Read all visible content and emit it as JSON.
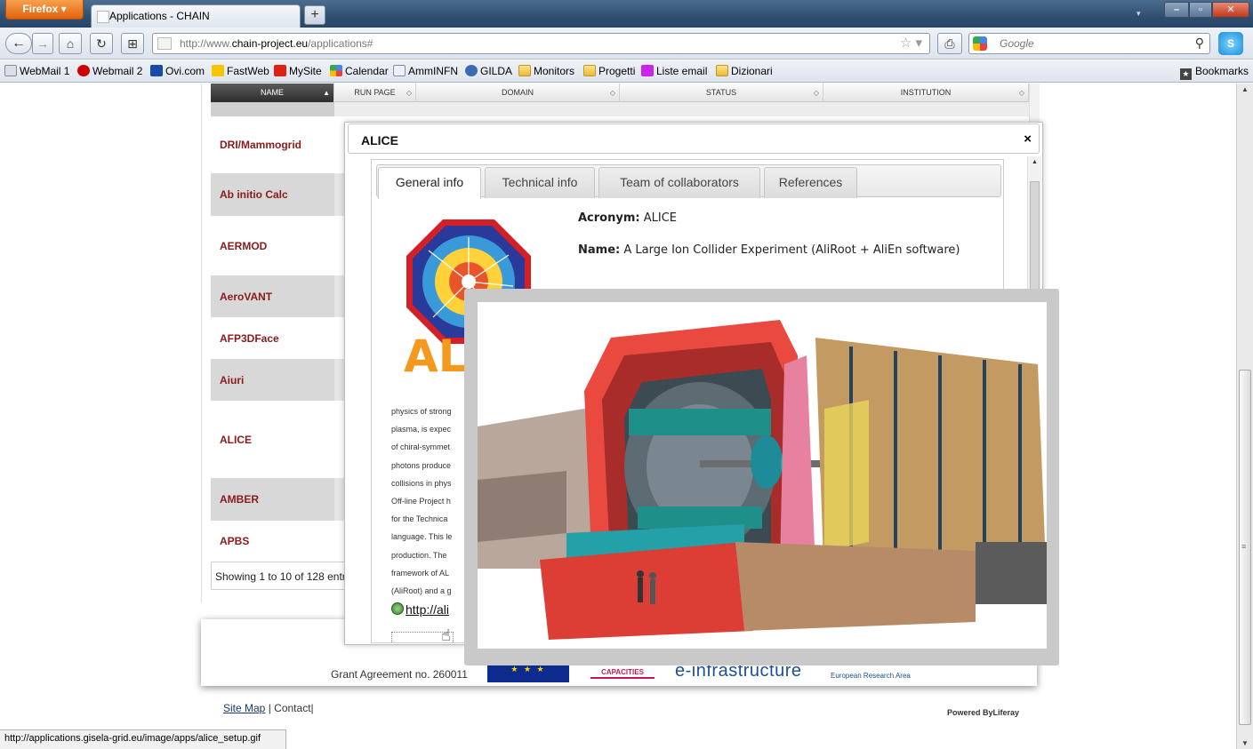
{
  "browser": {
    "menu_button": "Firefox ▾",
    "tab_title": "Applications - CHAIN",
    "new_tab": "+",
    "url_prefix": "http://www.",
    "url_domain": "chain-project.eu",
    "url_path": "/applications#",
    "search_placeholder": "Google",
    "bookmarks": [
      "WebMail 1",
      "Webmail 2",
      "Ovi.com",
      "FastWeb",
      "MySite",
      "Calendar",
      "AmmINFN",
      "GILDA",
      "Monitors",
      "Progetti",
      "Liste email",
      "Dizionari"
    ],
    "bookmarks_menu": "Bookmarks",
    "status_url": "http://applications.gisela-grid.eu/image/apps/alice_setup.gif"
  },
  "grid": {
    "columns": [
      "NAME",
      "RUN PAGE",
      "DOMAIN",
      "STATUS",
      "INSTITUTION"
    ],
    "rows": [
      "DRI/Mammogrid",
      "Ab initio Calc",
      "AERMOD",
      "AeroVANT",
      "AFP3DFace",
      "Aiuri",
      "ALICE",
      "AMBER",
      "APBS"
    ],
    "footer": "Showing 1 to 10 of 128 entries"
  },
  "dialog": {
    "title": "ALICE",
    "close": "×",
    "tabs": [
      "General info",
      "Technical info",
      "Team of collaborators",
      "References"
    ],
    "active_tab": "General info",
    "acronym_label": "Acronym:",
    "acronym_value": "ALICE",
    "name_label": "Name:",
    "name_value": "A Large Ion Collider Experiment (AliRoot + AliEn software)",
    "logo_text": "ALI",
    "description_lines": [
      "physics of strong",
      "plasma, is expec",
      "of chiral-symmet",
      "photons produce",
      "collisions in phys",
      "Off-line Project h",
      "for the Technica",
      "language. This le",
      "production. The",
      "framework of AL",
      "(AliRoot) and a g"
    ],
    "link_text": "http://ali"
  },
  "funding": {
    "grant": "Grant Agreement no. 260011",
    "eu_stars": "★ ★ ★",
    "capacities": "CAPACITIES",
    "einfra": "e-infrastructure",
    "era": "European Research Area"
  },
  "footer": {
    "site_map": "Site Map",
    "separator": "|",
    "contact": "Contact",
    "separator2": "|",
    "powered": "Powered ByLiferay"
  },
  "colors": {
    "row_name": "#8b1a1a",
    "grid_header_dark": "#3a3a3a",
    "alice_orange": "#f39a1e",
    "alice_red": "#d41f26",
    "alice_blue": "#2a3a9a"
  },
  "icons": [
    "back-icon",
    "forward-icon",
    "home-icon",
    "reload-icon",
    "tab-groups-icon",
    "bookmark-star-icon",
    "print-icon",
    "search-icon",
    "skype-icon",
    "globe-icon",
    "close-icon",
    "sort-icon",
    "hand-cursor-icon"
  ]
}
